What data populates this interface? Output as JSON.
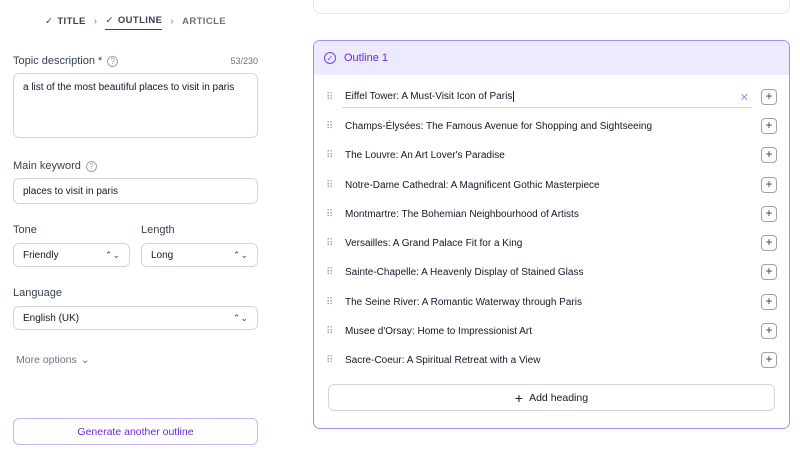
{
  "stepper": {
    "steps": [
      {
        "label": "TITLE",
        "state": "done"
      },
      {
        "label": "OUTLINE",
        "state": "active"
      },
      {
        "label": "ARTICLE",
        "state": "future"
      }
    ],
    "separator": ">"
  },
  "form": {
    "topic": {
      "label": "Topic description *",
      "counter": "53/230",
      "value": "a list of the most beautiful places to visit in paris"
    },
    "keyword": {
      "label": "Main keyword",
      "value": "places to visit in paris"
    },
    "tone": {
      "label": "Tone",
      "value": "Friendly"
    },
    "length": {
      "label": "Length",
      "value": "Long"
    },
    "language": {
      "label": "Language",
      "value": "English (UK)"
    },
    "more_options": "More options",
    "generate_button": "Generate another outline"
  },
  "outline": {
    "title": "Outline 1",
    "headings": [
      "Eiffel Tower: A Must-Visit Icon of Paris",
      "Champs-Élysées: The Famous Avenue for Shopping and Sightseeing",
      "The Louvre: An Art Lover's Paradise",
      "Notre-Dame Cathedral: A Magnificent Gothic Masterpiece",
      "Montmartre: The Bohemian Neighbourhood of Artists",
      "Versailles: A Grand Palace Fit for a King",
      "Sainte-Chapelle: A Heavenly Display of Stained Glass",
      "The Seine River: A Romantic Waterway through Paris",
      "Musee d'Orsay: Home to Impressionist Art",
      "Sacre-Coeur: A Spiritual Retreat with a View"
    ],
    "add_heading_label": "Add heading"
  },
  "colors": {
    "accent": "#7c3aed",
    "accent_light": "#ede9fe",
    "border": "#d1d5db"
  }
}
